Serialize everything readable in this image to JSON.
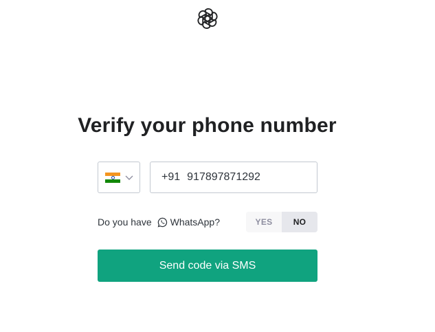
{
  "header": {
    "logo_icon": "openai-logo-icon"
  },
  "main": {
    "title": "Verify your phone number",
    "country": {
      "flag_icon": "india-flag-icon",
      "dropdown_icon": "chevron-down-icon"
    },
    "phone": {
      "dial_code": "+91",
      "number": "917897871292"
    },
    "whatsapp": {
      "question_prefix": "Do you have",
      "question_brand": "WhatsApp?",
      "icon": "whatsapp-icon",
      "yes_label": "YES",
      "no_label": "NO",
      "selected": "NO"
    },
    "submit_label": "Send code via SMS"
  },
  "colors": {
    "accent": "#10a37f",
    "text": "#202123",
    "border": "#c2c8d0"
  }
}
